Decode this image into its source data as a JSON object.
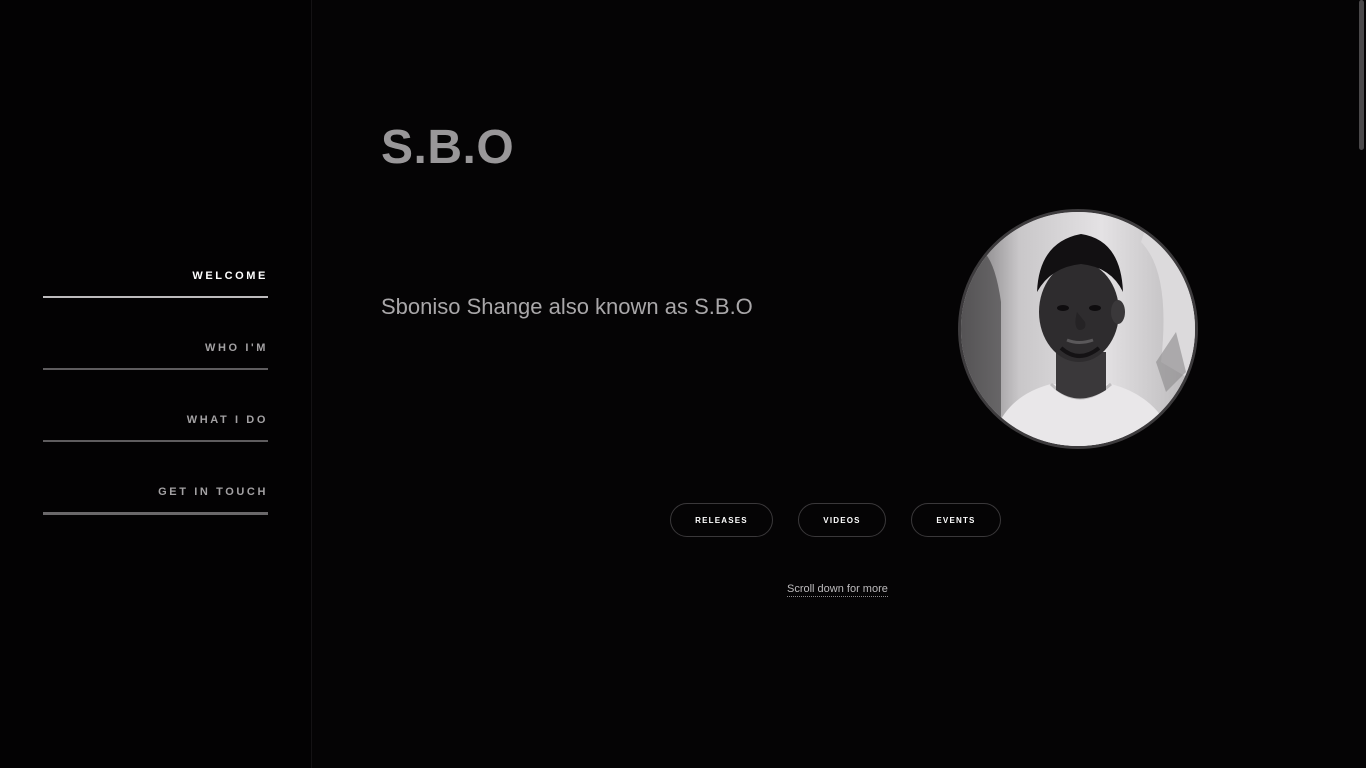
{
  "nav": {
    "items": [
      {
        "label": "WELCOME",
        "active": true
      },
      {
        "label": "WHO I'M",
        "active": false
      },
      {
        "label": "WHAT I DO",
        "active": false
      },
      {
        "label": "GET IN TOUCH",
        "active": false
      }
    ]
  },
  "hero": {
    "title": "S.B.O",
    "tagline": "Sboniso Shange also known as S.B.O",
    "avatar_icon": "portrait-photo"
  },
  "actions": {
    "releases": "RELEASES",
    "videos": "VIDEOS",
    "events": "EVENTS"
  },
  "scroll_hint": "Scroll down for more",
  "colors": {
    "background": "#050405",
    "sidebar": "#030203",
    "title": "#999799",
    "active_nav": "#ffffff",
    "inactive_nav": "#a3a1a3"
  }
}
